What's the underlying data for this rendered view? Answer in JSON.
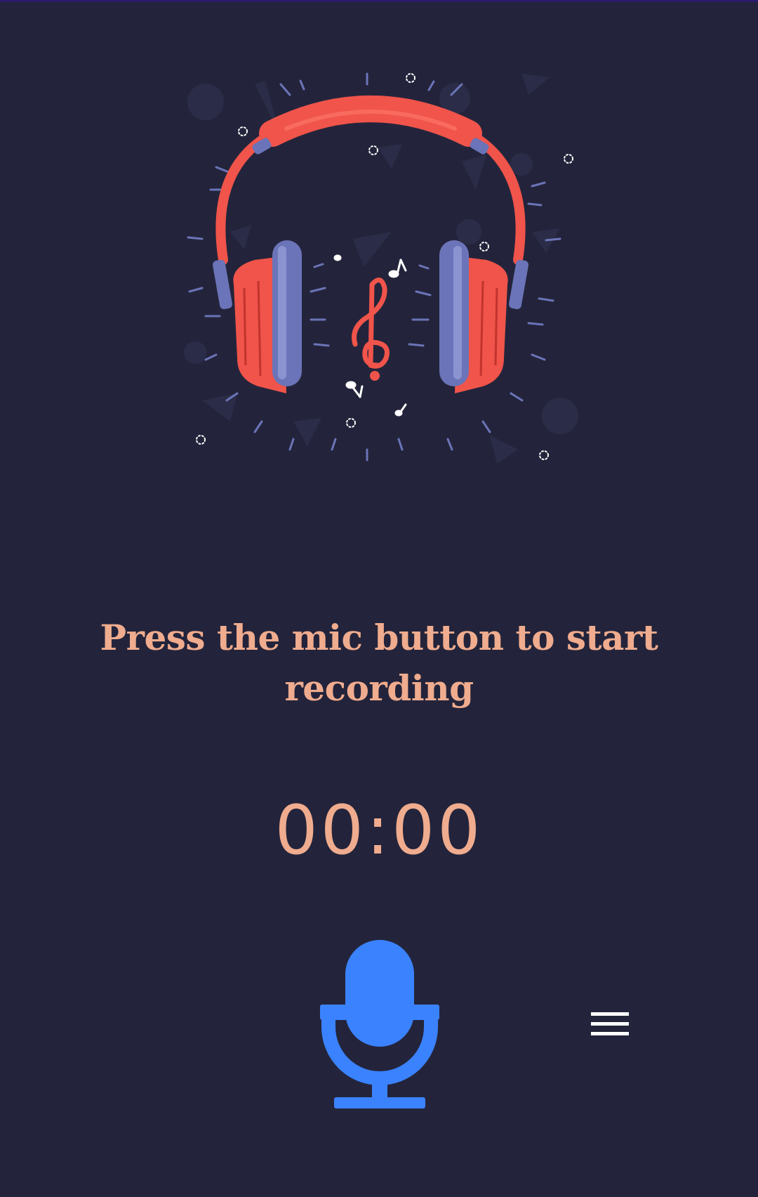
{
  "recorder": {
    "prompt_text": "Press the mic button to start recording",
    "timer_minutes": "00",
    "timer_separator": ":",
    "timer_seconds": "00"
  },
  "icons": {
    "illustration": "headphones-music-illustration",
    "mic": "microphone-icon",
    "menu": "hamburger-menu-icon"
  },
  "colors": {
    "background": "#23243b",
    "text_accent": "#f0ac8e",
    "mic_blue": "#3b82ff",
    "headphone_red": "#f0544a",
    "cushion_blue": "#6b74b8"
  }
}
